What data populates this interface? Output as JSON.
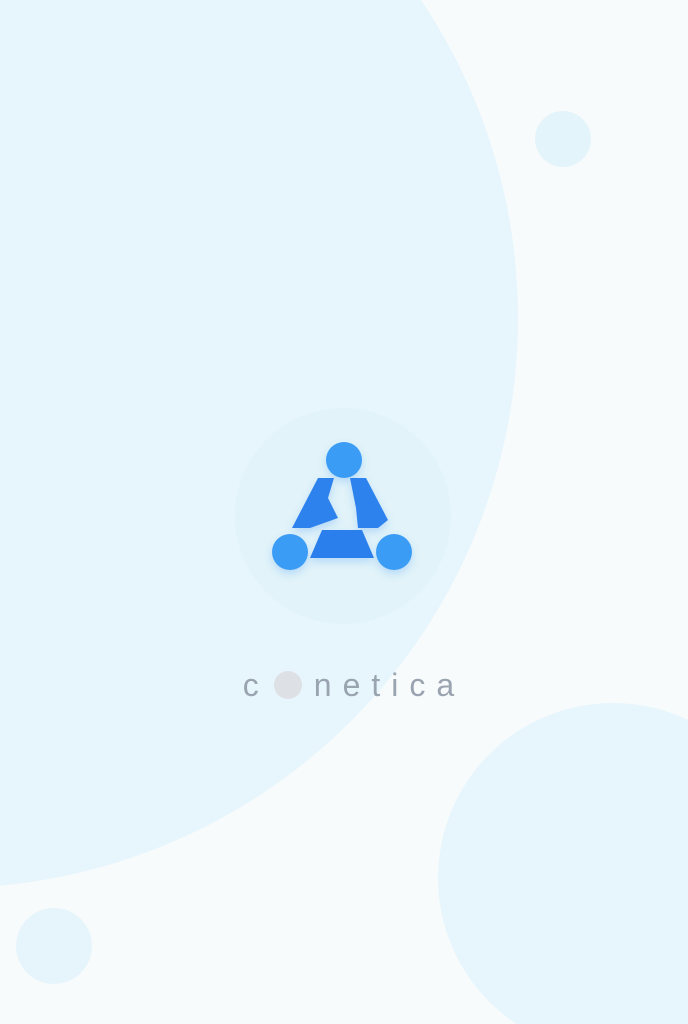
{
  "brand": {
    "name_before": "c",
    "name_after": "netica",
    "logo_icon": "triangle-nodes-logo",
    "colors": {
      "logo_primary": "#2f8cf3",
      "logo_accent": "#3ea2f7",
      "wordmark": "#9aa4b0",
      "background": "#f8fbfc",
      "blob": "#e6f6fc"
    }
  }
}
